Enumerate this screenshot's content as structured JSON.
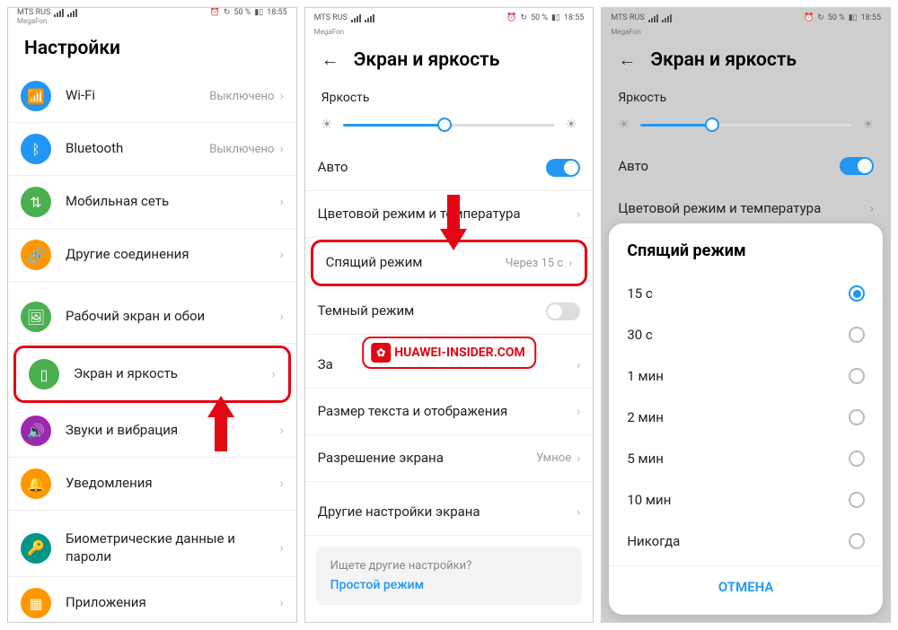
{
  "status": {
    "carrier": "MTS RUS",
    "sub": "MegaFon",
    "battery_pct": "50 %",
    "time": "18:55"
  },
  "screen1": {
    "title": "Настройки",
    "items": [
      {
        "label": "Wi-Fi",
        "value": "Выключено",
        "icon": "wifi",
        "color": "#2196f3"
      },
      {
        "label": "Bluetooth",
        "value": "Выключено",
        "icon": "bluetooth",
        "color": "#2196f3"
      },
      {
        "label": "Мобильная сеть",
        "value": "",
        "icon": "cell",
        "color": "#4caf50"
      },
      {
        "label": "Другие соединения",
        "value": "",
        "icon": "link",
        "color": "#ff9800"
      },
      {
        "label": "Рабочий экран и обои",
        "value": "",
        "icon": "image",
        "color": "#4caf50"
      },
      {
        "label": "Экран и яркость",
        "value": "",
        "icon": "phone",
        "color": "#4caf50",
        "highlight": true
      },
      {
        "label": "Звуки и вибрация",
        "value": "",
        "icon": "sound",
        "color": "#9c27b0"
      },
      {
        "label": "Уведомления",
        "value": "",
        "icon": "bell",
        "color": "#ff9800"
      },
      {
        "label": "Биометрические данные и пароли",
        "value": "",
        "icon": "key",
        "color": "#009688"
      },
      {
        "label": "Приложения",
        "value": "",
        "icon": "apps",
        "color": "#ff9800"
      }
    ]
  },
  "screen2": {
    "title": "Экран и яркость",
    "brightness_label": "Яркость",
    "brightness_pct": 48,
    "auto_label": "Авто",
    "auto_on": true,
    "items": [
      {
        "label": "Цветовой режим и температура",
        "value": ""
      },
      {
        "label": "Спящий режим",
        "value": "Через 15 с",
        "highlight": true
      },
      {
        "label": "Темный режим",
        "toggle": false
      },
      {
        "label": "За",
        "value": ""
      },
      {
        "label": "Размер текста и отображения",
        "value": ""
      },
      {
        "label": "Разрешение экрана",
        "value": "Умное"
      },
      {
        "label": "Другие настройки экрана",
        "value": ""
      }
    ],
    "suggest_q": "Ищете другие настройки?",
    "suggest_link": "Простой режим",
    "watermark": "HUAWEI-INSIDER.COM"
  },
  "screen3": {
    "title": "Экран и яркость",
    "brightness_label": "Яркость",
    "brightness_pct": 34,
    "auto_label": "Авто",
    "auto_on": true,
    "color_mode": "Цветовой режим и температура",
    "modal_title": "Спящий режим",
    "options": [
      {
        "label": "15 с",
        "checked": true
      },
      {
        "label": "30 с",
        "checked": false
      },
      {
        "label": "1 мин",
        "checked": false
      },
      {
        "label": "2 мин",
        "checked": false
      },
      {
        "label": "5 мин",
        "checked": false
      },
      {
        "label": "10 мин",
        "checked": false
      },
      {
        "label": "Никогда",
        "checked": false
      }
    ],
    "cancel": "ОТМЕНА"
  }
}
